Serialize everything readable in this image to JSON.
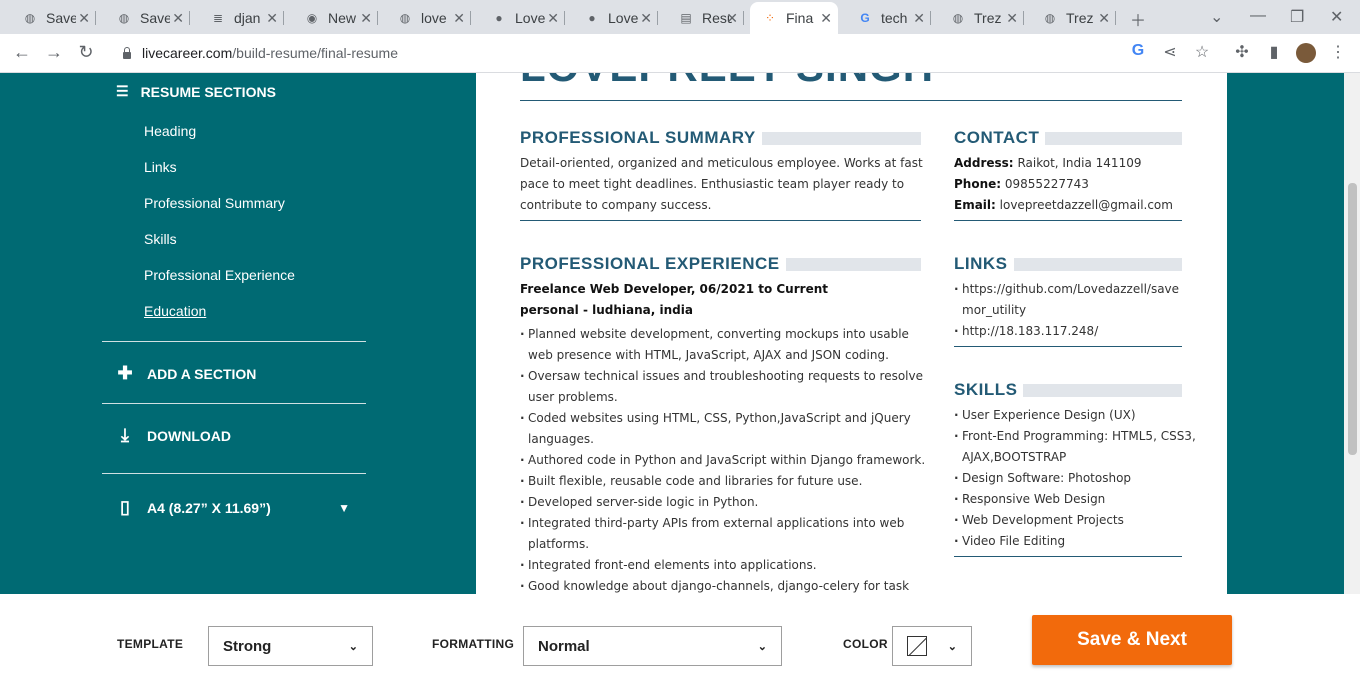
{
  "browser": {
    "tabs": [
      {
        "label": "Save",
        "icon": "globe-icon"
      },
      {
        "label": "Save",
        "icon": "globe-icon"
      },
      {
        "label": "djan",
        "icon": "stackoverflow-icon"
      },
      {
        "label": "New",
        "icon": "chrome-icon"
      },
      {
        "label": "love",
        "icon": "globe-icon"
      },
      {
        "label": "Love",
        "icon": "github-icon"
      },
      {
        "label": "Love",
        "icon": "github-icon"
      },
      {
        "label": "Resu",
        "icon": "doc-icon"
      },
      {
        "label": "Fina",
        "icon": "livecareer-icon",
        "active": true
      },
      {
        "label": "tech",
        "icon": "google-icon"
      },
      {
        "label": "Trez",
        "icon": "globe-icon"
      },
      {
        "label": "Trez",
        "icon": "globe-icon"
      }
    ],
    "url_host": "livecareer.com",
    "url_path": "/build-resume/final-resume"
  },
  "sidebar": {
    "section_title": "RESUME SECTIONS",
    "items": [
      "Heading",
      "Links",
      "Professional Summary",
      "Skills",
      "Professional Experience",
      "Education"
    ],
    "add_section": "ADD A SECTION",
    "download": "DOWNLOAD",
    "paper_size": "A4 (8.27” X 11.69”)"
  },
  "resume": {
    "name": "LOVEPREET SINGH",
    "summary_title": "PROFESSIONAL SUMMARY",
    "summary_lines": [
      "Detail-oriented, organized and meticulous employee. Works at fast",
      "pace to meet tight deadlines. Enthusiastic team player ready to",
      "contribute to company success."
    ],
    "experience_title": "PROFESSIONAL EXPERIENCE",
    "job_title": "Freelance Web Developer, 06/2021 to Current",
    "job_company": "personal - ludhiana, india",
    "bullets": [
      [
        "Planned website development, converting mockups into usable",
        "web presence with HTML, JavaScript, AJAX and JSON coding."
      ],
      [
        "Oversaw technical issues and troubleshooting requests to resolve",
        "user problems."
      ],
      [
        "Coded websites using HTML, CSS, Python,JavaScript and jQuery",
        "languages."
      ],
      [
        "Authored code in Python and JavaScript within Django framework."
      ],
      [
        "Built flexible, reusable code and libraries for future use."
      ],
      [
        "Developed server-side logic in Python."
      ],
      [
        "Integrated third-party APIs from external applications into web",
        "platforms."
      ],
      [
        "Integrated front-end elements into applications."
      ],
      [
        "Good knowledge about django-channels, django-celery for task"
      ]
    ],
    "contact_title": "CONTACT",
    "contact": {
      "address_label": "Address:",
      "address": "Raikot, India 141109",
      "phone_label": "Phone:",
      "phone": "09855227743",
      "email_label": "Email:",
      "email": "lovepreetdazzell@gmail.com"
    },
    "links_title": "LINKS",
    "links": [
      [
        "https://github.com/Lovedazzell/save",
        "mor_utility"
      ],
      [
        "http://18.183.117.248/"
      ]
    ],
    "skills_title": "SKILLS",
    "skills": [
      [
        "User Experience Design (UX)"
      ],
      [
        "Front-End Programming: HTML5, CSS3,",
        "AJAX,BOOTSTRAP"
      ],
      [
        "Design Software: Photoshop"
      ],
      [
        "Responsive Web Design"
      ],
      [
        "Web Development Projects"
      ],
      [
        "Video File Editing"
      ]
    ]
  },
  "bottom": {
    "template_label": "TEMPLATE",
    "template_value": "Strong",
    "formatting_label": "FORMATTING",
    "formatting_value": "Normal",
    "color_label": "COLOR",
    "save_label": "Save & Next"
  },
  "colors": {
    "accent": "#f26a0c",
    "sidebar_bg": "#006a73",
    "heading": "#235a75"
  }
}
